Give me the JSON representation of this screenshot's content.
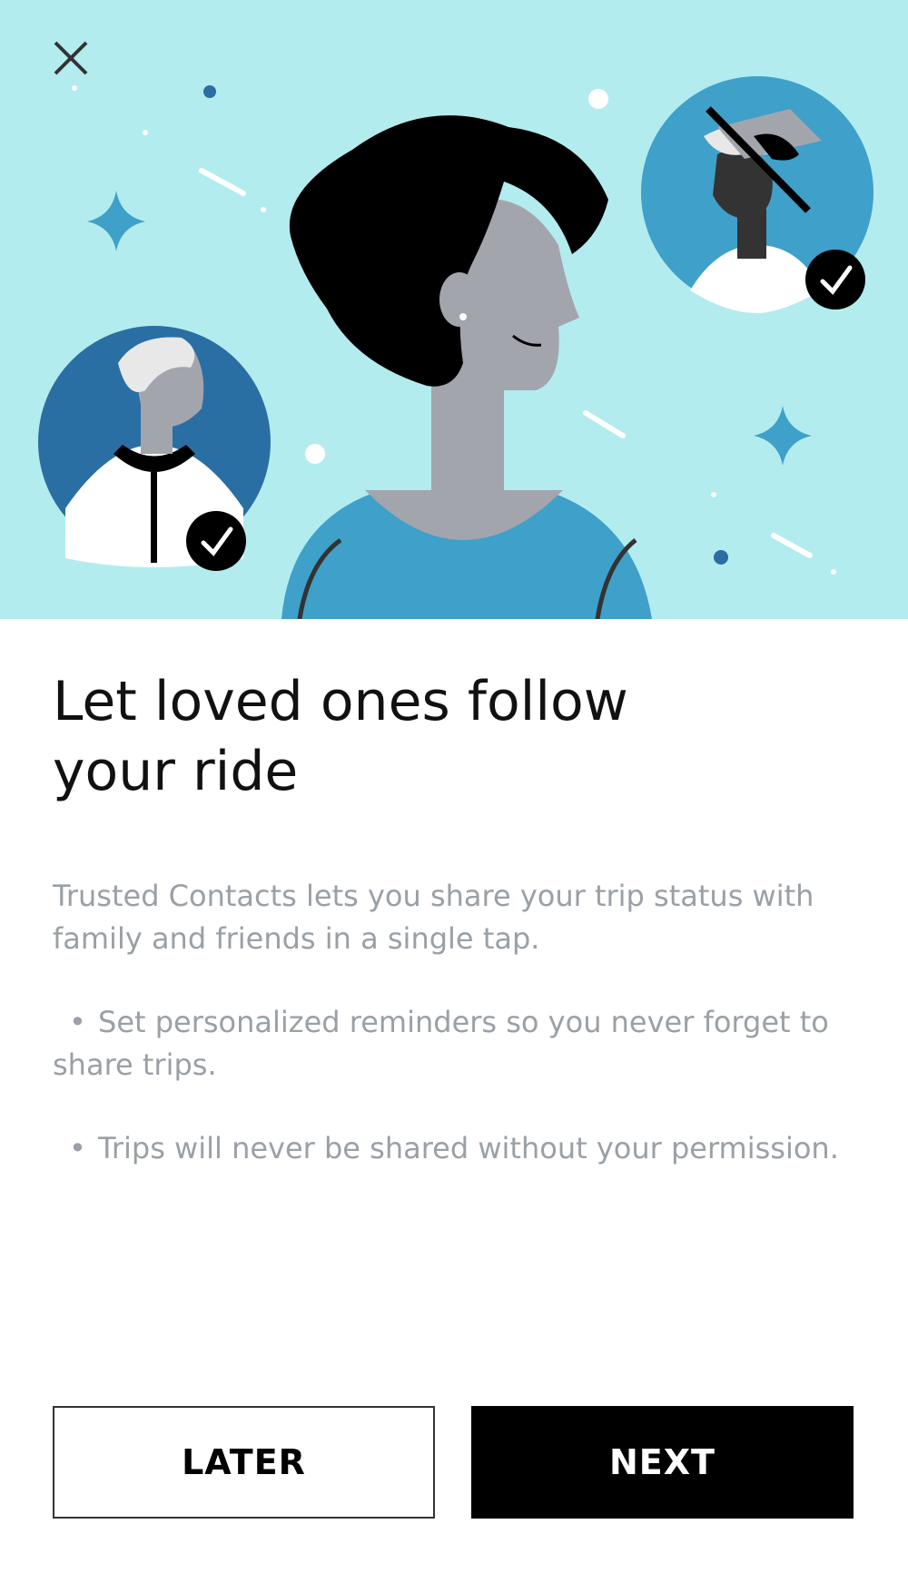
{
  "onboarding": {
    "title": "Let loved ones follow your ride",
    "description": "Trusted Contacts lets you share your trip status with family and friends in a single tap.",
    "bullets": [
      "Set personalized reminders so you never forget to share trips.",
      "Trips will never be shared without your permission."
    ],
    "bullet_glyph": "•"
  },
  "actions": {
    "later_label": "LATER",
    "next_label": "NEXT"
  },
  "icons": {
    "close": "close-icon",
    "check": "check-icon"
  },
  "colors": {
    "hero_background": "#b3ecee",
    "accent_blue": "#3fa0c9",
    "primary_button": "#000000",
    "body_text": "#9aa0a6"
  }
}
